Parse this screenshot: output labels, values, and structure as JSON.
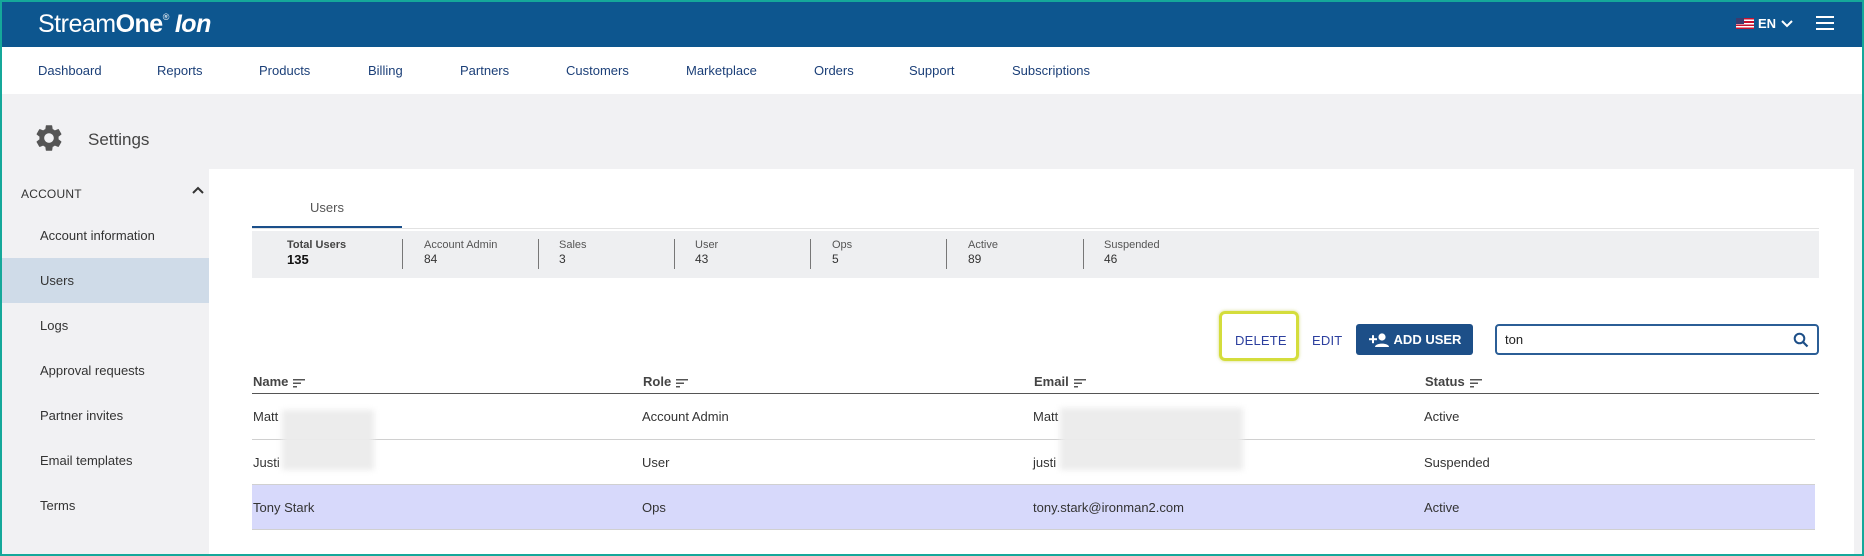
{
  "header": {
    "logo_part1": "Stream",
    "logo_part2": "One",
    "logo_reg": "®",
    "logo_part3": "Ion",
    "language": "EN",
    "colors": {
      "topbar": "#0d568f",
      "accent": "#1d4f88"
    }
  },
  "nav": {
    "items": [
      "Dashboard",
      "Reports",
      "Products",
      "Billing",
      "Partners",
      "Customers",
      "Marketplace",
      "Orders",
      "Support",
      "Subscriptions"
    ]
  },
  "page": {
    "title": "Settings"
  },
  "sidebar": {
    "section": "ACCOUNT",
    "items": [
      {
        "label": "Account information",
        "active": false
      },
      {
        "label": "Users",
        "active": true
      },
      {
        "label": "Logs",
        "active": false
      },
      {
        "label": "Approval requests",
        "active": false
      },
      {
        "label": "Partner invites",
        "active": false
      },
      {
        "label": "Email templates",
        "active": false
      },
      {
        "label": "Terms",
        "active": false
      }
    ]
  },
  "tabs": {
    "active": "Users"
  },
  "stats": [
    {
      "label": "Total Users",
      "value": "135"
    },
    {
      "label": "Account Admin",
      "value": "84"
    },
    {
      "label": "Sales",
      "value": "3"
    },
    {
      "label": "User",
      "value": "43"
    },
    {
      "label": "Ops",
      "value": "5"
    },
    {
      "label": "Active",
      "value": "89"
    },
    {
      "label": "Suspended",
      "value": "46"
    }
  ],
  "toolbar": {
    "delete_label": "DELETE",
    "edit_label": "EDIT",
    "add_user_label": "ADD USER",
    "search_value": "ton"
  },
  "table": {
    "columns": [
      "Name",
      "Role",
      "Email",
      "Status"
    ],
    "rows": [
      {
        "name": "Matt",
        "role": "Account Admin",
        "email": "Matt",
        "status": "Active",
        "selected": false
      },
      {
        "name": "Justi",
        "role": "User",
        "email": "justi",
        "status": "Suspended",
        "selected": false
      },
      {
        "name": "Tony Stark",
        "role": "Ops",
        "email": "tony.stark@ironman2.com",
        "status": "Active",
        "selected": true
      }
    ]
  }
}
